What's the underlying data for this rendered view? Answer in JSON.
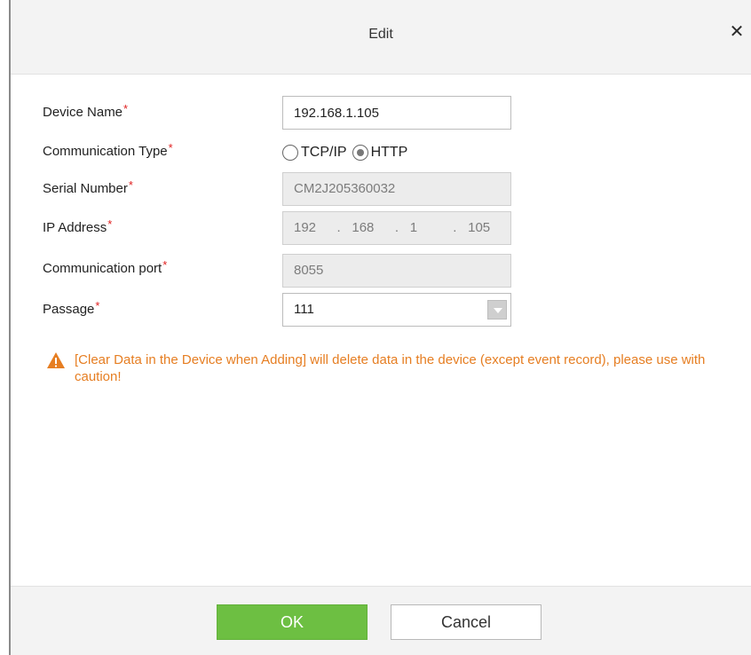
{
  "dialog": {
    "title": "Edit",
    "close_symbol": "✕"
  },
  "form": {
    "device_name": {
      "label": "Device Name",
      "required": "*",
      "value": "192.168.1.105"
    },
    "communication_type": {
      "label": "Communication Type",
      "required": "*",
      "options": [
        "TCP/IP",
        "HTTP"
      ],
      "selected": "HTTP"
    },
    "serial_number": {
      "label": "Serial Number",
      "required": "*",
      "value": "CM2J205360032"
    },
    "ip_address": {
      "label": "IP Address",
      "required": "*",
      "segments": [
        "192",
        "168",
        "1",
        "105"
      ]
    },
    "communication_port": {
      "label": "Communication port",
      "required": "*",
      "value": "8055"
    },
    "passage": {
      "label": "Passage",
      "required": "*",
      "value": "111"
    }
  },
  "warning": {
    "text": "[Clear Data in the Device when Adding] will delete data in the device (except event record), please use with caution!",
    "color": "#e67e22"
  },
  "footer": {
    "ok_label": "OK",
    "cancel_label": "Cancel"
  },
  "colors": {
    "ok_button": "#6dbf42",
    "required_marker": "#e02020"
  }
}
